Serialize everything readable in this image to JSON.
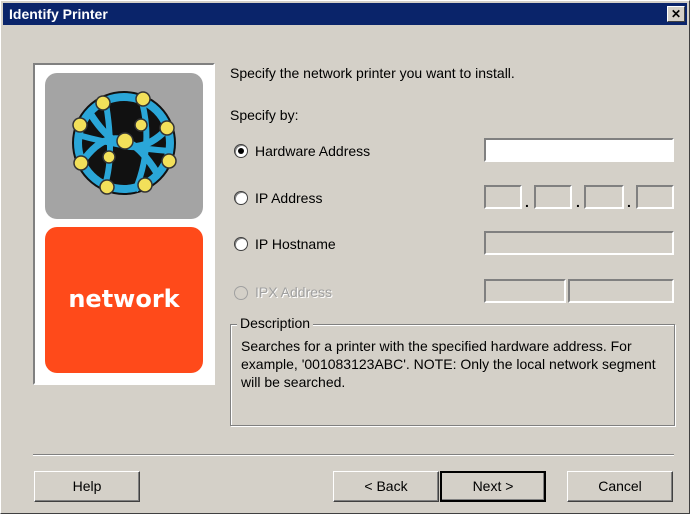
{
  "window": {
    "title": "Identify Printer",
    "close_glyph": "✕"
  },
  "logo": {
    "word": "network",
    "top_color": "#a4a4a4",
    "bottom_color": "#ff4a1a"
  },
  "intro": "Specify the network printer you want to install.",
  "specify_by": "Specify by:",
  "options": [
    {
      "label": "Hardware Address",
      "selected": true,
      "enabled": true
    },
    {
      "label": "IP Address",
      "selected": false,
      "enabled": true
    },
    {
      "label": "IP Hostname",
      "selected": false,
      "enabled": true
    },
    {
      "label": "IPX Address",
      "selected": false,
      "enabled": false
    }
  ],
  "fields": {
    "hardware_address": "",
    "ip_octets": [
      "",
      "",
      "",
      ""
    ],
    "ip_separator": ".",
    "hostname": "",
    "ipx_network": "",
    "ipx_node": ""
  },
  "description": {
    "title": "Description",
    "text": "Searches for a printer with the specified hardware address. For example, '001083123ABC'.  NOTE: Only the local network segment will be searched."
  },
  "buttons": {
    "help": "Help",
    "back": "< Back",
    "next": "Next >",
    "cancel": "Cancel"
  },
  "colors": {
    "titlebar": "#0a246a",
    "dialog": "#d4d0c8"
  }
}
